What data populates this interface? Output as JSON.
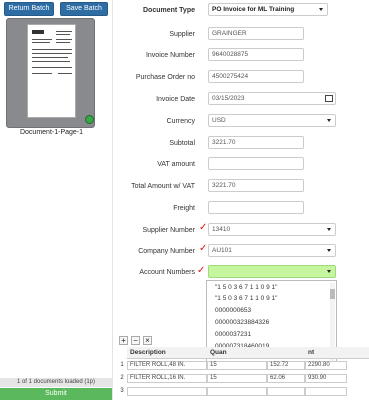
{
  "left": {
    "return_batch": "Return Batch",
    "save_batch": "Save Batch",
    "thumbnail_label": "Document-1-Page-1",
    "loaded_status": "1 of 1 documents loaded (1p)",
    "submit": "Submit"
  },
  "form": {
    "document_type": {
      "label": "Document Type",
      "value": "PO Invoice for ML Training"
    },
    "supplier": {
      "label": "Supplier",
      "value": "GRAINGER"
    },
    "invoice_number": {
      "label": "Invoice Number",
      "value": "9640028875"
    },
    "purchase_order": {
      "label": "Purchase Order no",
      "value": "4500275424"
    },
    "invoice_date": {
      "label": "Invoice Date",
      "value": "03/15/2023"
    },
    "currency": {
      "label": "Currency",
      "value": "USD"
    },
    "subtotal": {
      "label": "Subtotal",
      "value": "3221.70"
    },
    "vat_amount": {
      "label": "VAT amount",
      "value": ""
    },
    "total_amount": {
      "label": "Total Amount w/ VAT",
      "value": "3221.70"
    },
    "freight": {
      "label": "Freight",
      "value": ""
    },
    "supplier_number": {
      "label": "Supplier Number",
      "value": "13410"
    },
    "company_number": {
      "label": "Company Number",
      "value": "AU101"
    },
    "account_numbers": {
      "label": "Account Numbers",
      "value": ""
    }
  },
  "dropdown": {
    "options": [
      "\"1 5 0 3 6 7 1 1 0 9 1\"",
      "\"1 5 0 3 6 7 1 1 0 9 1\"",
      "0000000653",
      "000000323884326",
      "0000037231",
      "000007318460019",
      "0000101001777",
      "0000101001777"
    ]
  },
  "grid": {
    "toolbar": {
      "add": "+",
      "remove": "−",
      "clear": "×"
    },
    "headers": [
      "Description",
      "Quan",
      "",
      "nt"
    ],
    "rows": [
      {
        "num": "1",
        "desc": "FILTER ROLL,48 IN.",
        "qty": "15",
        "price": "152.72",
        "amount": "2290.80"
      },
      {
        "num": "2",
        "desc": "FILTER ROLL,16 IN.",
        "qty": "15",
        "price": "62.06",
        "amount": "930.90"
      },
      {
        "num": "3",
        "desc": "",
        "qty": "",
        "price": "",
        "amount": ""
      }
    ]
  },
  "colors": {
    "primary": "#2e6da4",
    "success": "#5cb85c",
    "selected_field": "#c6f5a0",
    "check": "#dd1111"
  }
}
